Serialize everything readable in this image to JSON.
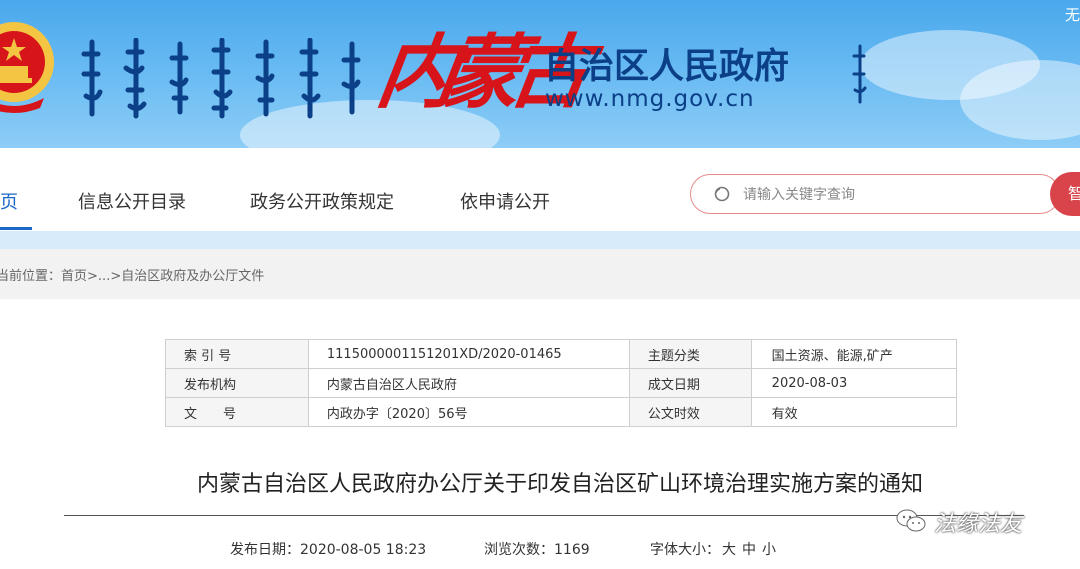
{
  "header": {
    "site_name": "自治区人民政府",
    "site_url": "www.nmg.gov.cn",
    "region_calligraphy": "内蒙古",
    "top_right_text": "无"
  },
  "nav": {
    "items": [
      {
        "label": "页",
        "active": true
      },
      {
        "label": "信息公开目录"
      },
      {
        "label": "政务公开政策规定"
      },
      {
        "label": "依申请公开"
      }
    ],
    "search": {
      "placeholder": "请输入关键字查询",
      "button_label": "智"
    }
  },
  "breadcrumb": {
    "prefix": "当前位置：",
    "home": "首页",
    "sep1": ">...>",
    "current": "自治区政府及办公厅文件"
  },
  "info_table": {
    "rows": [
      {
        "k1": "索 引 号",
        "v1": "1115000001151201XD/2020-01465",
        "k2": "主题分类",
        "v2": "国土资源、能源,矿产"
      },
      {
        "k1": "发布机构",
        "v1": "内蒙古自治区人民政府",
        "k2": "成文日期",
        "v2": "2020-08-03"
      },
      {
        "k1": "文　　号",
        "v1": "内政办字〔2020〕56号",
        "k2": "公文时效",
        "v2": "有效"
      }
    ]
  },
  "article": {
    "title": "内蒙古自治区人民政府办公厅关于印发自治区矿山环境治理实施方案的通知",
    "publish_label": "发布日期：",
    "publish_value": "2020-08-05 18:23",
    "views_label": "浏览次数：",
    "views_value": "1169",
    "font_label": "字体大小：",
    "font_sizes": [
      "大",
      "中",
      "小"
    ]
  },
  "watermark": {
    "text": "法缘法友"
  },
  "colors": {
    "banner_blue": "#4aa8ec",
    "title_navy": "#0b3f87",
    "accent_red": "#d8444a",
    "nav_active": "#1b67c8"
  }
}
